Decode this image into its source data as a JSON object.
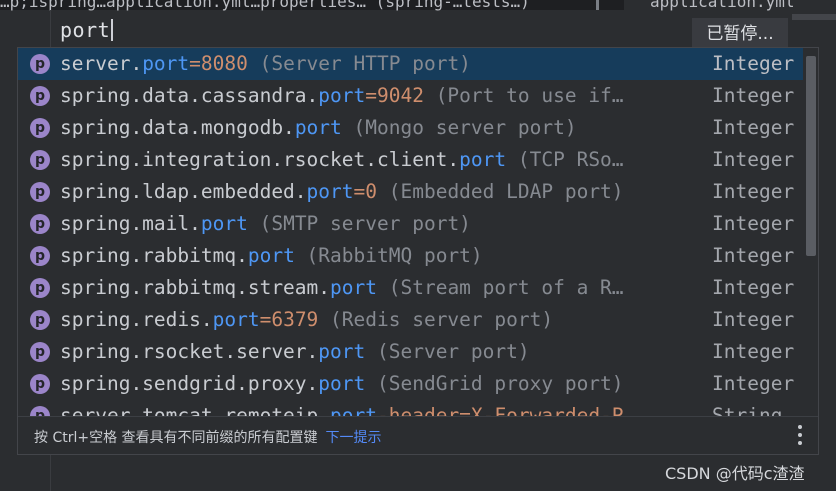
{
  "tab": {
    "left_text": "…p;ispring…application.yml…properties… (spring-…tests…)",
    "right_text": "application.yml"
  },
  "query": "port",
  "status_badge": "已暂停...",
  "suggestions": [
    {
      "prefix": "server.",
      "key": "port",
      "value": "=8080",
      "desc": " (Server HTTP port)",
      "type": "Integer"
    },
    {
      "prefix": "spring.data.cassandra.",
      "key": "port",
      "value": "=9042",
      "desc": " (Port to use if…",
      "type": "Integer"
    },
    {
      "prefix": "spring.data.mongodb.",
      "key": "port",
      "value": "",
      "desc": " (Mongo server port)",
      "type": "Integer"
    },
    {
      "prefix": "spring.integration.rsocket.client.",
      "key": "port",
      "value": "",
      "desc": " (TCP RSo…",
      "type": "Integer"
    },
    {
      "prefix": "spring.ldap.embedded.",
      "key": "port",
      "value": "=0",
      "desc": " (Embedded LDAP port)",
      "type": "Integer"
    },
    {
      "prefix": "spring.mail.",
      "key": "port",
      "value": "",
      "desc": " (SMTP server port)",
      "type": "Integer"
    },
    {
      "prefix": "spring.rabbitmq.",
      "key": "port",
      "value": "",
      "desc": " (RabbitMQ port)",
      "type": "Integer"
    },
    {
      "prefix": "spring.rabbitmq.stream.",
      "key": "port",
      "value": "",
      "desc": " (Stream port of a R…",
      "type": "Integer"
    },
    {
      "prefix": "spring.redis.",
      "key": "port",
      "value": "=6379",
      "desc": " (Redis server port)",
      "type": "Integer"
    },
    {
      "prefix": "spring.rsocket.server.",
      "key": "port",
      "value": "",
      "desc": " (Server port)",
      "type": "Integer"
    },
    {
      "prefix": "spring.sendgrid.proxy.",
      "key": "port",
      "value": "",
      "desc": " (SendGrid proxy port)",
      "type": "Integer"
    },
    {
      "prefix": "server.tomcat.remoteip.",
      "key": "port",
      "value": "-header=X-Forwarded-P…",
      "desc": "",
      "type": "String"
    }
  ],
  "icon_letter": "p",
  "footer": {
    "hint": "按 Ctrl+空格 查看具有不同前缀的所有配置键",
    "next_tip": "下一提示"
  },
  "watermark": "CSDN @代码c渣渣",
  "colors": {
    "selected_row": "#163c5b",
    "match_highlight": "#4e97f5",
    "default_value": "#cf8e6d",
    "property_icon": "#9b85c9"
  }
}
